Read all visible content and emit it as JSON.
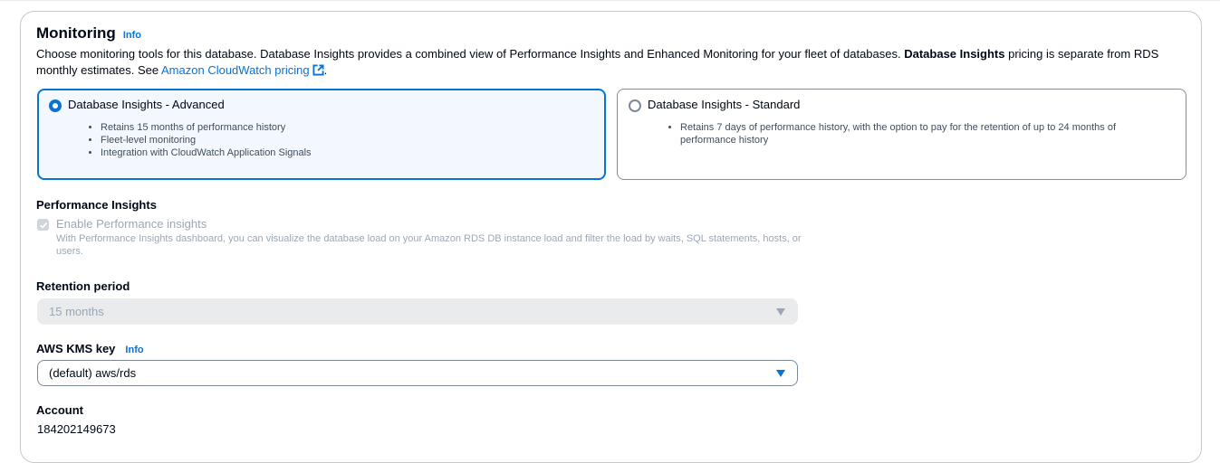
{
  "monitoring": {
    "title": "Monitoring",
    "info_label": "Info",
    "description_pre": "Choose monitoring tools for this database. Database Insights provides a combined view of Performance Insights and Enhanced Monitoring for your fleet of databases. ",
    "description_bold": "Database Insights",
    "description_post": " pricing is separate from RDS monthly estimates. See ",
    "pricing_link": "Amazon CloudWatch pricing",
    "description_end": "."
  },
  "options": [
    {
      "label": "Database Insights - Advanced",
      "selected": true,
      "bullets": [
        "Retains 15 months of performance history",
        "Fleet-level monitoring",
        "Integration with CloudWatch Application Signals"
      ]
    },
    {
      "label": "Database Insights - Standard",
      "selected": false,
      "bullets": [
        "Retains 7 days of performance history, with the option to pay for the retention of up to 24 months of performance history"
      ]
    }
  ],
  "performance_insights": {
    "heading": "Performance Insights",
    "checkbox_label": "Enable Performance insights",
    "checked": true,
    "disabled": true,
    "description": "With Performance Insights dashboard, you can visualize the database load on your Amazon RDS DB instance load and filter the load by waits, SQL statements, hosts, or users."
  },
  "retention": {
    "label": "Retention period",
    "value": "15 months",
    "disabled": true
  },
  "kms": {
    "label": "AWS KMS key",
    "info_label": "Info",
    "value": "(default) aws/rds"
  },
  "account": {
    "label": "Account",
    "value": "184202149673"
  },
  "colors": {
    "accent": "#0972d3",
    "selected_bg": "#f2f8fd",
    "disabled_text": "#9ba7b6",
    "disabled_bg": "#e9ebed",
    "border": "#c6c6cd"
  },
  "icons": {
    "external_link": "external-link-icon",
    "dropdown": "caret-down-icon",
    "check": "check-icon"
  }
}
